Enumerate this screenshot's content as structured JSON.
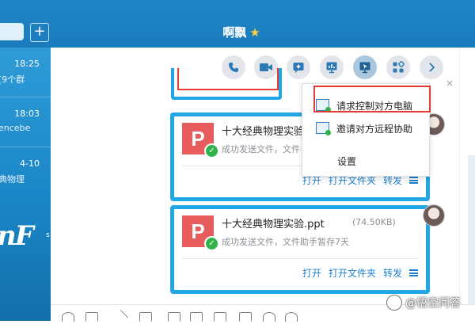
{
  "window": {
    "title": "啊飘",
    "title_star": "★",
    "add_label": "+"
  },
  "sidebar": {
    "conversations": [
      {
        "time": "18:25",
        "preview": "[9个群"
      },
      {
        "time": "18:03",
        "preview": "encebe"
      },
      {
        "time": "4-10",
        "preview": "典物理"
      }
    ],
    "brand": "nF",
    "brand_suffix": "s"
  },
  "toolbar": {
    "icons": [
      "phone-icon",
      "video-icon",
      "add-chat-icon",
      "screen-share-icon",
      "remote-desktop-icon",
      "apps-icon",
      "chevron-right-icon"
    ],
    "active": "remote-desktop-icon"
  },
  "dropdown": {
    "items": [
      {
        "label": "请求控制对方电脑"
      },
      {
        "label": "邀请对方远程协助"
      },
      {
        "label": "设置"
      }
    ]
  },
  "messages": [
    {
      "file_name": "十大经典物理实验",
      "file_size": "",
      "status": "成功发送文件，文件",
      "file_icon": "P",
      "actions": {
        "open": "打开",
        "open_folder": "打开文件夹",
        "forward": "转发"
      }
    },
    {
      "file_name": "十大经典物理实验.ppt",
      "file_size": "(74.50KB)",
      "status": "成功发送文件，文件助手暂存7天",
      "file_icon": "P",
      "actions": {
        "open": "打开",
        "open_folder": "打开文件夹",
        "forward": "转发"
      }
    }
  ],
  "prev_message": {
    "close": "×"
  },
  "watermark": "@悟空问答",
  "colors": {
    "accent": "#21a6e6",
    "title_bar": "#1a7bbd",
    "highlight": "#e53935",
    "file_icon": "#e75c5c",
    "link": "#1f7fcc"
  }
}
